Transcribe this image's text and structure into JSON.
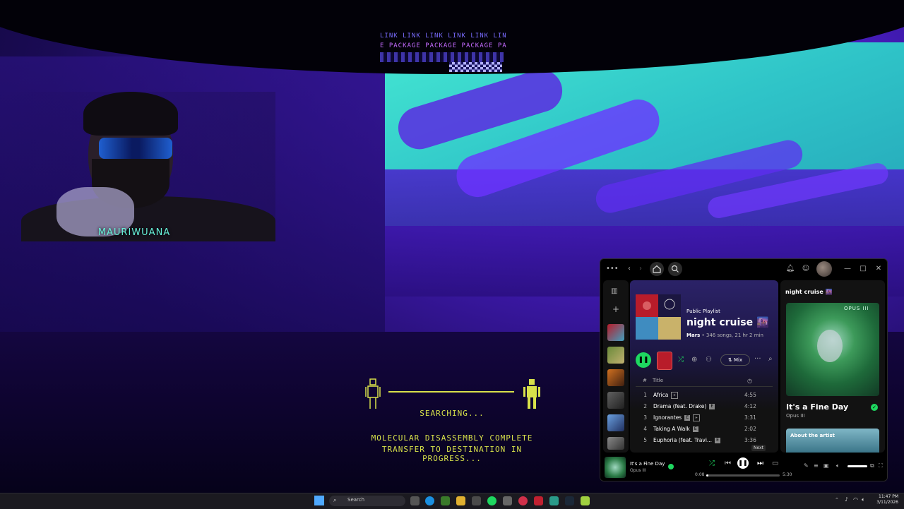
{
  "banner": {
    "row1": "LINK  LINK  LINK  LINK  LINK  LIN",
    "row2": "E  PACKAGE  PACKAGE  PACKAGE  PA"
  },
  "webcam": {
    "streamer_name": "MAURIWUANA"
  },
  "hud": {
    "status": "SEARCHING...",
    "message_line1": "MOLECULAR DISASSEMBLY COMPLETE",
    "message_line2": "TRANSFER TO DESTINATION IN PROGRESS..."
  },
  "spotify": {
    "titlebar": {
      "menu": "•••",
      "back": "‹",
      "forward": "›",
      "minimize": "—",
      "maximize": "□",
      "close": "✕"
    },
    "playlist": {
      "type": "Public Playlist",
      "title": "night cruise 🌆",
      "owner": "Mars",
      "meta": " • 346 songs, 21 hr 2 min",
      "mix_label": "Mix",
      "columns": {
        "number": "#",
        "title": "Title"
      },
      "tracks": [
        {
          "num": "1",
          "title": "Africa",
          "duration": "4:55"
        },
        {
          "num": "2",
          "title": "Drama (feat. Drake)",
          "explicit": "E",
          "duration": "4:12"
        },
        {
          "num": "3",
          "title": "Ignorantes",
          "explicit": "E",
          "duration": "3:31"
        },
        {
          "num": "4",
          "title": "Taking A Walk",
          "explicit": "E",
          "duration": "2:02"
        },
        {
          "num": "5",
          "title": "Euphoria (feat. Travi...",
          "explicit": "E",
          "duration": "3:36"
        }
      ]
    },
    "now_playing": {
      "panel_label": "night cruise 🌆",
      "art_text": "OPUS III",
      "title": "It's a Fine Day",
      "artist": "Opus III",
      "about_label": "About the artist"
    },
    "player": {
      "title": "It's a Fine Day",
      "artist": "Opus III",
      "tooltip": "Next",
      "time_current": "0:08",
      "time_total": "5:30",
      "progress": 0.025
    }
  },
  "taskbar": {
    "search_label": "Search",
    "time": "11:47 PM",
    "date": "3/11/2026"
  },
  "colors": {
    "accent": "#1ed760",
    "hud": "#d8e14a",
    "sky": "#44e6d2"
  }
}
